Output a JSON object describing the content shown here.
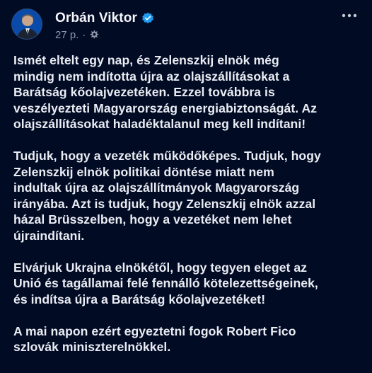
{
  "post": {
    "author": {
      "name": "Orbán Viktor",
      "verified": true,
      "avatar_icon": "profile-photo"
    },
    "meta": {
      "time": "27 p.",
      "separator": "·",
      "audience_icon": "gear-icon"
    },
    "more_icon": "more-horizontal-icon",
    "paragraphs": [
      {
        "lines": [
          "Ismét eltelt egy nap, és Zelenszkij elnök még",
          "mindig nem indította újra az olajszállításokat a",
          "Barátság kőolajvezetéken. Ezzel továbbra is",
          "veszélyezteti Magyarország energiabiztonságát. Az",
          "olajszállításokat haladéktalanul meg kell indítani!"
        ]
      },
      {
        "lines": [
          "Tudjuk, hogy a vezeték működőképes. Tudjuk, hogy",
          "Zelenszkij elnök politikai döntése miatt nem",
          "indultak újra az olajszállítmányok Magyarország",
          "irányába. Azt is tudjuk, hogy Zelenszkij elnök azzal",
          "házal Brüsszelben, hogy a vezetéket nem lehet",
          "újraindítani."
        ]
      },
      {
        "lines": [
          "Elvárjuk Ukrajna elnökétől, hogy tegyen eleget az",
          "Unió és tagállamai felé fennálló kötelezettségeinek,",
          "és indítsa újra a Barátság kőolajvezetéket!"
        ]
      },
      {
        "lines": [
          "A mai napon ezért egyeztetni fogok Robert Fico",
          "szlovák miniszterelnökkel."
        ]
      }
    ],
    "colors": {
      "background": "#020b24",
      "text": "#e9ecf3",
      "muted": "#8f97a8",
      "verified": "#1d9bf0"
    }
  }
}
